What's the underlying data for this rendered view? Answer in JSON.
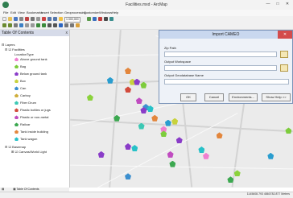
{
  "window": {
    "title": "Facilities.mxd - ArcMap",
    "minimize": "—",
    "maximize": "□",
    "close": "✕"
  },
  "menu": [
    "File",
    "Edit",
    "View",
    "Bookmarks",
    "Insert",
    "Selection",
    "Geoprocessing",
    "Customize",
    "Windows",
    "Help"
  ],
  "toolbar": {
    "scale": "1:300,000"
  },
  "toc": {
    "title": "Table Of Contents",
    "close": "x",
    "layers_label": "Layers",
    "facilities_label": "Facilities",
    "field_label": "LocationType",
    "legend": [
      {
        "label": "Above ground tank",
        "color": "#f07fd0"
      },
      {
        "label": "Bag",
        "color": "#7dcc3c"
      },
      {
        "label": "Below ground tank",
        "color": "#8a3cc8"
      },
      {
        "label": "Box",
        "color": "#c8d23c"
      },
      {
        "label": "Can",
        "color": "#3c8fcf"
      },
      {
        "label": "Carboy",
        "color": "#cfae3c"
      },
      {
        "label": "Fiber Drum",
        "color": "#3cc8b4"
      },
      {
        "label": "Plastic bottles or jugs",
        "color": "#d24b3c"
      },
      {
        "label": "Plastic or non-metal",
        "color": "#c04cc0"
      },
      {
        "label": "Railcar",
        "color": "#3ca850"
      },
      {
        "label": "Tank inside building",
        "color": "#e3863c"
      },
      {
        "label": "Tank wagon",
        "color": "#27c1c8"
      }
    ],
    "basemap_label": "Basemap",
    "basemap_sublayer": "Canvas/World Light",
    "bottom_tab": "Table Of Contents"
  },
  "dialog": {
    "title": "Import CAMEO",
    "close": "✕",
    "field1_label": "Zip Path",
    "field2_label": "Output Workspace",
    "field3_label": "Output Geodatabase Name",
    "buttons": {
      "ok": "OK",
      "cancel": "Cancel",
      "env": "Environments...",
      "help": "Show Help >>"
    }
  },
  "status": {
    "coords": "1145608.793  4860782.877 Meters"
  },
  "map_points": [
    {
      "color": "#2a9dcf",
      "x": 18,
      "y": 32
    },
    {
      "color": "#3ca850",
      "x": 21,
      "y": 56
    },
    {
      "color": "#8a3cc8",
      "x": 14,
      "y": 79
    },
    {
      "color": "#3cc8b4",
      "x": 32,
      "y": 61
    },
    {
      "color": "#e3863c",
      "x": 26,
      "y": 26
    },
    {
      "color": "#8bd23c",
      "x": 9,
      "y": 43
    },
    {
      "color": "#7dcc3c",
      "x": 33,
      "y": 35
    },
    {
      "color": "#d24b3c",
      "x": 26,
      "y": 38
    },
    {
      "color": "#c8d23c",
      "x": 28,
      "y": 33
    },
    {
      "color": "#8a3cc8",
      "x": 30,
      "y": 33
    },
    {
      "color": "#c04cc0",
      "x": 31,
      "y": 45
    },
    {
      "color": "#3c8fcf",
      "x": 34,
      "y": 49
    },
    {
      "color": "#27c1c8",
      "x": 36,
      "y": 50
    },
    {
      "color": "#8a3cc8",
      "x": 33,
      "y": 51
    },
    {
      "color": "#e3863c",
      "x": 38,
      "y": 56
    },
    {
      "color": "#2a9dcf",
      "x": 44,
      "y": 59
    },
    {
      "color": "#f07fd0",
      "x": 42,
      "y": 63
    },
    {
      "color": "#7dcc3c",
      "x": 42,
      "y": 66
    },
    {
      "color": "#8a3cc8",
      "x": 26,
      "y": 74
    },
    {
      "color": "#27c1c8",
      "x": 29,
      "y": 75
    },
    {
      "color": "#c8d23c",
      "x": 47,
      "y": 58
    },
    {
      "color": "#3ca850",
      "x": 46,
      "y": 85
    },
    {
      "color": "#c04cc0",
      "x": 45,
      "y": 79
    },
    {
      "color": "#3c8fcf",
      "x": 26,
      "y": 93
    },
    {
      "color": "#e3863c",
      "x": 67,
      "y": 67
    },
    {
      "color": "#8bd23c",
      "x": 75,
      "y": 91
    },
    {
      "color": "#3ca850",
      "x": 72,
      "y": 95
    },
    {
      "color": "#27c1c8",
      "x": 59,
      "y": 76
    },
    {
      "color": "#f07fd0",
      "x": 61,
      "y": 80
    },
    {
      "color": "#2a9dcf",
      "x": 90,
      "y": 80
    },
    {
      "color": "#7dcc3c",
      "x": 98,
      "y": 64
    },
    {
      "color": "#8a3cc8",
      "x": 49,
      "y": 70
    }
  ]
}
